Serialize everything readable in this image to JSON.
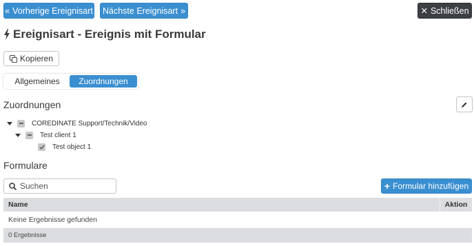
{
  "toolbar": {
    "prev_label": "Vorherige Ereignisart",
    "next_label": "Nächste Ereignisart",
    "close_label": "Schließen"
  },
  "page": {
    "title": "Ereignisart - Ereignis mit Formular",
    "copy_label": "Kopieren"
  },
  "tabs": [
    {
      "label": "Allgemeines",
      "active": false
    },
    {
      "label": "Zuordnungen",
      "active": true
    }
  ],
  "assignments": {
    "title": "Zuordnungen",
    "tree": [
      {
        "label": "COREDINATE Support/Technik/Video",
        "state": "partial",
        "expanded": true
      },
      {
        "label": "Test client 1",
        "state": "partial",
        "expanded": true
      },
      {
        "label": "Test object 1",
        "state": "checked"
      }
    ]
  },
  "forms": {
    "title": "Formulare",
    "search_placeholder": "Suchen",
    "add_label": "Formular hinzufügen",
    "columns": [
      "Name",
      "Aktion"
    ],
    "empty_text": "Keine Ergebnisse gefunden",
    "result_count": "0 Ergebnisse"
  },
  "colors": {
    "primary": "#3a8fd1",
    "dark_button": "#3c3f43",
    "table_header": "#dbdde0"
  }
}
